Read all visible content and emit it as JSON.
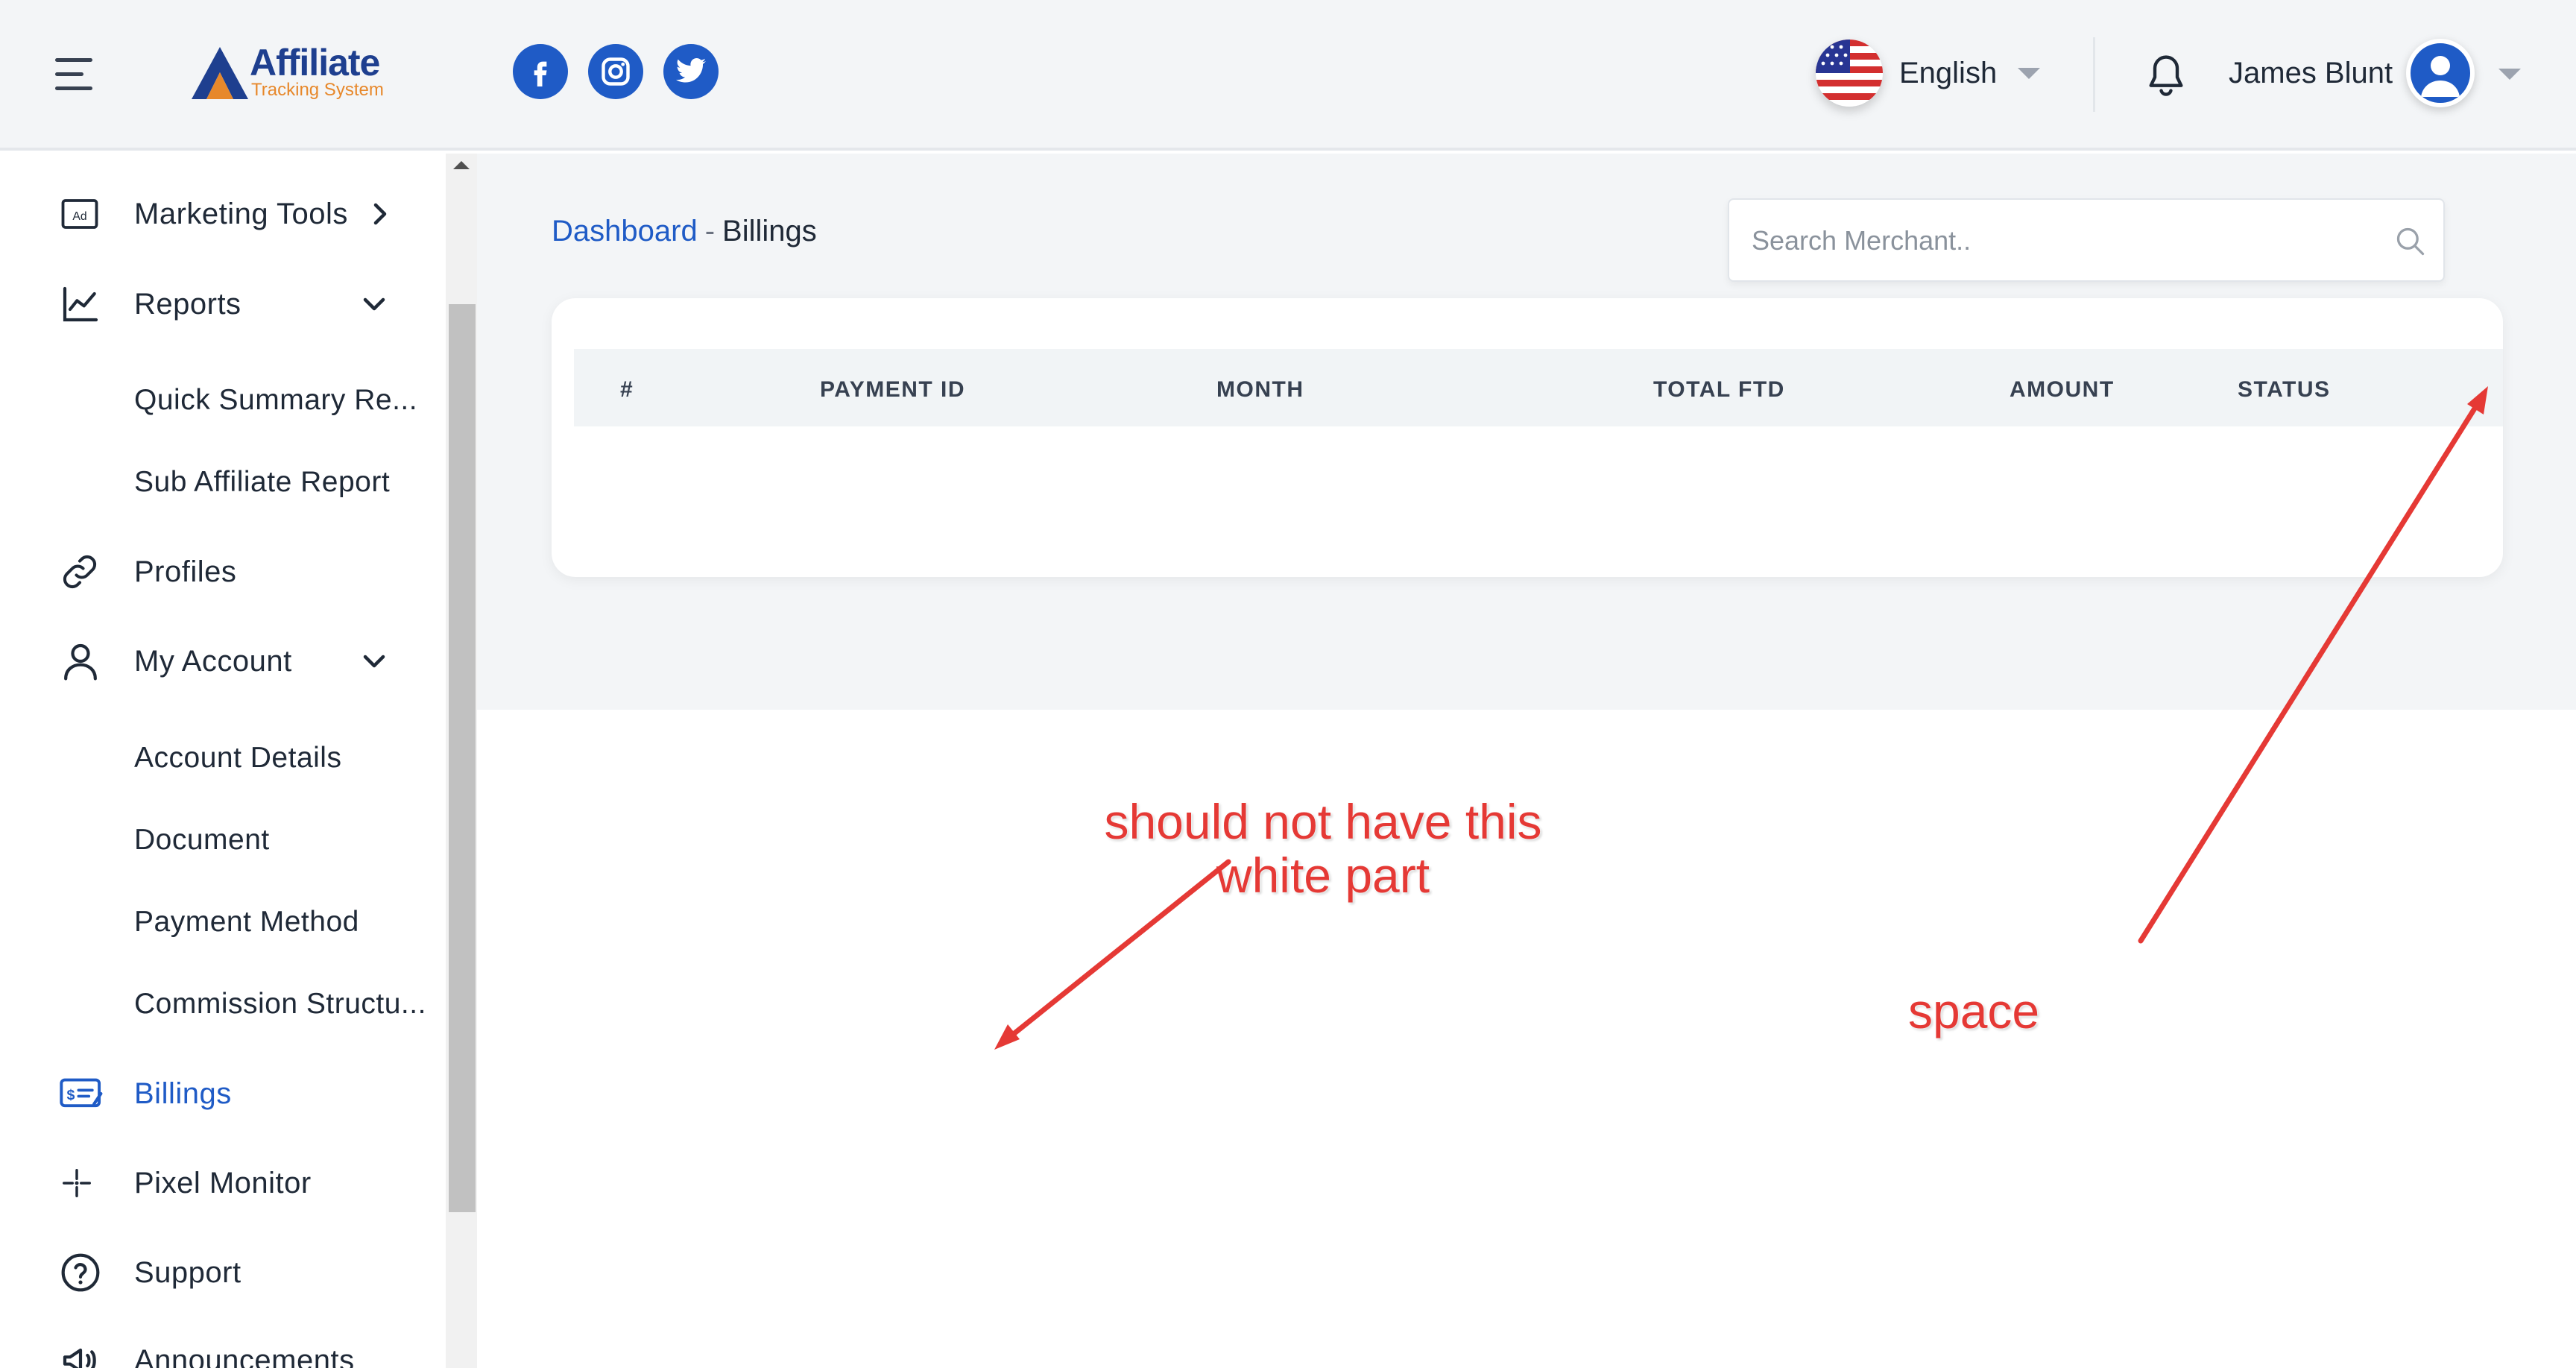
{
  "header": {
    "logo": {
      "title": "Affiliate",
      "subtitle": "Tracking System"
    },
    "social": [
      "facebook-icon",
      "instagram-icon",
      "twitter-icon"
    ],
    "language": {
      "label": "English",
      "flag": "us-flag-icon"
    },
    "user": {
      "name": "James Blunt"
    }
  },
  "sidebar": {
    "items": [
      {
        "label": "Marketing Tools",
        "icon": "ad-icon",
        "chevron": "right"
      },
      {
        "label": "Reports",
        "icon": "chart-line-icon",
        "chevron": "down"
      },
      {
        "label": "Quick Summary Re...",
        "sub": true
      },
      {
        "label": "Sub Affiliate Report",
        "sub": true
      },
      {
        "label": "Profiles",
        "icon": "link-icon"
      },
      {
        "label": "My Account",
        "icon": "user-icon",
        "chevron": "down"
      },
      {
        "label": "Account Details",
        "sub": true
      },
      {
        "label": "Document",
        "sub": true
      },
      {
        "label": "Payment Method",
        "sub": true
      },
      {
        "label": "Commission Structu...",
        "sub": true
      },
      {
        "label": "Billings",
        "icon": "billing-icon",
        "active": true
      },
      {
        "label": "Pixel Monitor",
        "icon": "sparkle-icon"
      },
      {
        "label": "Support",
        "icon": "help-circle-icon"
      },
      {
        "label": "Announcements",
        "icon": "megaphone-icon"
      }
    ]
  },
  "breadcrumb": {
    "root": "Dashboard",
    "separator": "-",
    "current": "Billings"
  },
  "search": {
    "placeholder": "Search Merchant.."
  },
  "table": {
    "columns": [
      "#",
      "PAYMENT ID",
      "MONTH",
      "TOTAL FTD",
      "AMOUNT",
      "STATUS"
    ]
  },
  "annotations": {
    "note_line1": "should not have this",
    "note_line2": "white part",
    "space": "space"
  },
  "colors": {
    "accent": "#1f5bc6",
    "annotation": "#e53935",
    "background": "#f3f5f7"
  }
}
